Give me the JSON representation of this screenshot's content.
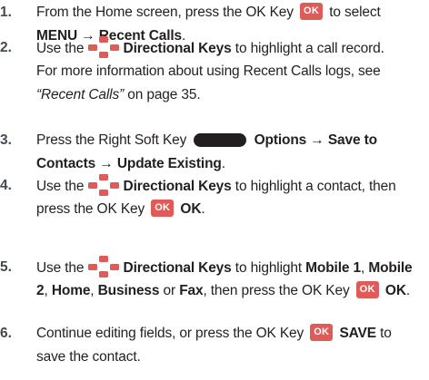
{
  "steps": [
    {
      "number": "1.",
      "line1": {
        "text1": "From the Home screen, press the OK Key",
        "ok_label": "OK",
        "text2": "to select"
      },
      "line2": {
        "menu": "MENU",
        "arrow": "→",
        "recent": "Recent Calls",
        "period": "."
      }
    },
    {
      "number": "2.",
      "line1": {
        "bold": "Directional Keys",
        "text": "to highlight a call record."
      },
      "line2": {
        "text": "For more information about using Recent Calls logs, see"
      },
      "line3": {
        "italic": "“Recent Calls”",
        "text": "on page 35."
      }
    },
    {
      "number": "3.",
      "line1": {
        "text": "Press the Right Soft Key",
        "options": "Options",
        "arrow": "→",
        "save": "Save to"
      },
      "line2": {
        "contacts": "Contacts",
        "arrow": "→",
        "update": "Update Existing",
        "period": "."
      }
    },
    {
      "number": "4.",
      "line1": {
        "text1": "Use the",
        "bold": "Directional Keys",
        "text2": "to highlight a contact, then"
      },
      "line2": {
        "text": "press  the OK Key",
        "ok_label": "OK",
        "bold_ok": "OK",
        "period": "."
      }
    },
    {
      "number": "5.",
      "line1": {
        "text1": "Use the",
        "bold": "Directional Keys",
        "text2": "to highlight",
        "mobile1": "Mobile 1",
        "comma": ",",
        "mobile": "Mobile"
      },
      "line2": {
        "two": "2",
        "c1": ",",
        "home": "Home",
        "c2": ",",
        "business": "Business",
        "or": "or",
        "fax": "Fax",
        "text": ", then press the OK Key",
        "ok_label": "OK",
        "bold_ok": "OK",
        "period": "."
      }
    },
    {
      "number": "6.",
      "line1": {
        "text": "Continue editing fields, or press the OK Key",
        "ok_label": "OK",
        "save": "SAVE",
        "to": "to"
      },
      "line2": {
        "text": "save the contact."
      }
    }
  ],
  "icons": {
    "ok_key_color": "#e05a58",
    "directional_key_color": "#e05a58",
    "soft_key_color": "#231f20"
  }
}
